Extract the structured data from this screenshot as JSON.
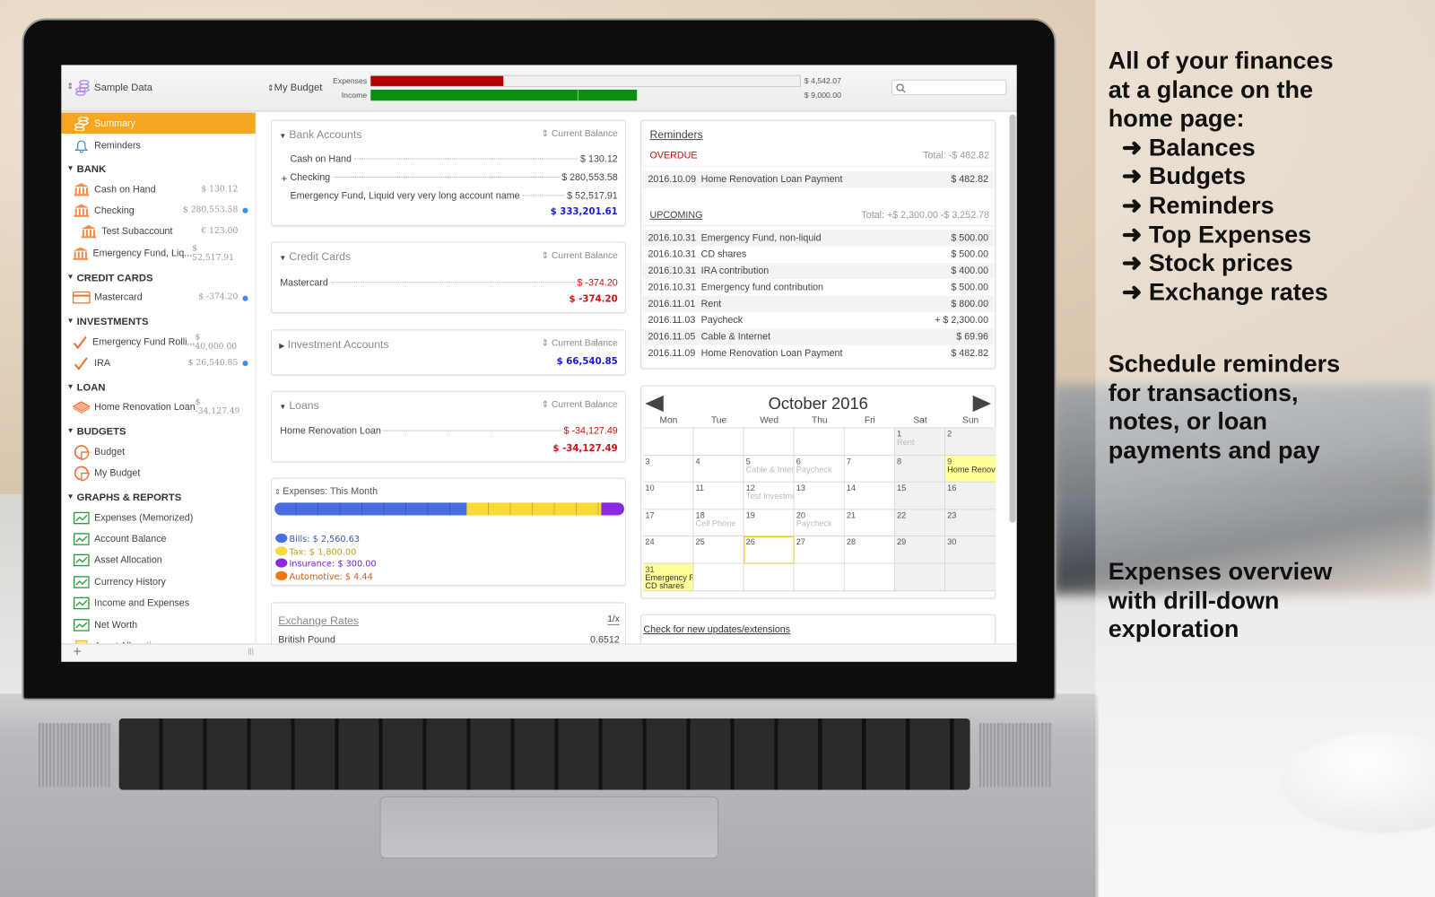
{
  "toolbar": {
    "file_name": "Sample Data",
    "budget_name": "My Budget",
    "expenses_label": "Expenses",
    "income_label": "Income",
    "expenses_amount": "$ 4,542.07",
    "income_amount": "$ 9,000.00",
    "expenses_fill_percent": 31,
    "income_fill_percent": 62,
    "income_marker_percent": 48,
    "expenses_color": "#b30000",
    "income_color": "#0a8f12",
    "search_placeholder": ""
  },
  "sidebar": {
    "accent": "#f5a623",
    "top": [
      {
        "label": "Summary",
        "icon": "coins-icon",
        "selected": true
      },
      {
        "label": "Reminders",
        "icon": "bell-icon"
      }
    ],
    "groups": [
      {
        "title": "BANK",
        "items": [
          {
            "label": "Cash on Hand",
            "value": "$ 130.12",
            "icon": "bank-icon"
          },
          {
            "label": "Checking",
            "value": "$ 280,553.58",
            "icon": "bank-icon",
            "dot": true
          },
          {
            "label": "Test Subaccount",
            "value": "€ 123.00",
            "icon": "bank-icon",
            "indent": true
          },
          {
            "label": "Emergency Fund, Liq...",
            "value": "$ 52,517.91",
            "icon": "bank-icon"
          }
        ]
      },
      {
        "title": "CREDIT CARDS",
        "items": [
          {
            "label": "Mastercard",
            "value": "$ -374.20",
            "icon": "credit-card-icon",
            "dot": true
          }
        ]
      },
      {
        "title": "INVESTMENTS",
        "items": [
          {
            "label": "Emergency Fund Rolli...",
            "value": "$ 40,000.00",
            "icon": "investment-icon"
          },
          {
            "label": "IRA",
            "value": "$ 26,540.85",
            "icon": "investment-icon",
            "dot": true
          }
        ]
      },
      {
        "title": "LOAN",
        "items": [
          {
            "label": "Home Renovation Loan",
            "value": "$ -34,127.49",
            "icon": "loan-icon"
          }
        ]
      },
      {
        "title": "BUDGETS",
        "items": [
          {
            "label": "Budget",
            "icon": "budget-icon"
          },
          {
            "label": "My Budget",
            "icon": "budget-icon"
          }
        ]
      },
      {
        "title": "GRAPHS & REPORTS",
        "items": [
          {
            "label": "Expenses (Memorized)",
            "icon": "graph-icon"
          },
          {
            "label": "Account Balance",
            "icon": "graph-icon"
          },
          {
            "label": "Asset Allocation",
            "icon": "graph-icon"
          },
          {
            "label": "Currency History",
            "icon": "graph-icon"
          },
          {
            "label": "Income and Expenses",
            "icon": "graph-icon"
          },
          {
            "label": "Net Worth",
            "icon": "graph-icon"
          },
          {
            "label": "Asset Allocation",
            "icon": "report-icon"
          }
        ]
      }
    ]
  },
  "bottombar": {
    "add_label": "+",
    "handle_label": "|||"
  },
  "cards": {
    "bank": {
      "title": "Bank Accounts",
      "sort": "Current Balance",
      "rows": [
        {
          "label": "Cash on Hand",
          "amount": "$ 130.12"
        },
        {
          "label": "Checking",
          "amount": "$ 280,553.58",
          "expand": "+"
        },
        {
          "label": "Emergency Fund, Liquid very very long account name",
          "amount": "$ 52,517.91"
        }
      ],
      "total": "$ 333,201.61"
    },
    "credit": {
      "title": "Credit Cards",
      "sort": "Current Balance",
      "rows": [
        {
          "label": "Mastercard",
          "amount": "$ -374.20"
        }
      ],
      "total": "$ -374.20"
    },
    "investment": {
      "title": "Investment Accounts",
      "sort": "Current Balance",
      "total": "$ 66,540.85"
    },
    "loans": {
      "title": "Loans",
      "sort": "Current Balance",
      "rows": [
        {
          "label": "Home Renovation Loan",
          "amount": "$ -34,127.49"
        }
      ],
      "total": "$ -34,127.49"
    },
    "expenses": {
      "title": "Expenses: This Month",
      "categories": [
        {
          "name": "Bills",
          "amount": "$ 2,560.63",
          "value": 2560.63,
          "color": "#4a6ee0",
          "text_color": "#3a55c0"
        },
        {
          "name": "Tax",
          "amount": "$ 1,800.00",
          "value": 1800.0,
          "color": "#f7d93a",
          "text_color": "#b8a020"
        },
        {
          "name": "Insurance",
          "amount": "$ 300.00",
          "value": 300.0,
          "color": "#8a2be2",
          "text_color": "#7a1fd0"
        },
        {
          "name": "Automotive",
          "amount": "$ 4.44",
          "value": 4.44,
          "color": "#f07a10",
          "text_color": "#d06010"
        }
      ]
    },
    "exchange": {
      "title": "Exchange Rates",
      "toggle": "1/x",
      "rows": [
        {
          "label": "British Pound",
          "value": "0.6512"
        }
      ]
    },
    "reminders": {
      "title": "Reminders",
      "overdue": {
        "label": "OVERDUE",
        "total": "Total:  -$ 482.82",
        "rows": [
          {
            "date": "2016.10.09",
            "desc": "Home Renovation Loan Payment",
            "amount": "$ 482.82"
          }
        ]
      },
      "upcoming": {
        "label": "UPCOMING",
        "total": "Total:  +$ 2,300.00 -$ 3,252.78",
        "rows": [
          {
            "date": "2016.10.31",
            "desc": "Emergency Fund, non-liquid",
            "amount": "$ 500.00"
          },
          {
            "date": "2016.10.31",
            "desc": "CD shares",
            "amount": "$ 500.00"
          },
          {
            "date": "2016.10.31",
            "desc": "IRA contribution",
            "amount": "$ 400.00"
          },
          {
            "date": "2016.10.31",
            "desc": "Emergency fund contribution",
            "amount": "$ 500.00"
          },
          {
            "date": "2016.11.01",
            "desc": "Rent",
            "amount": "$ 800.00"
          },
          {
            "date": "2016.11.03",
            "desc": "Paycheck",
            "amount": "+ $ 2,300.00"
          },
          {
            "date": "2016.11.05",
            "desc": "Cable & Internet",
            "amount": "$ 69.96"
          },
          {
            "date": "2016.11.09",
            "desc": "Home Renovation Loan Payment",
            "amount": "$ 482.82"
          }
        ]
      }
    },
    "calendar": {
      "title": "October 2016",
      "weekdays": [
        "Mon",
        "Tue",
        "Wed",
        "Thu",
        "Fri",
        "Sat",
        "Sun"
      ],
      "today": 26,
      "highlight_color": "#ffff99",
      "weeks": [
        [
          null,
          null,
          null,
          null,
          null,
          1,
          2
        ],
        [
          3,
          4,
          5,
          6,
          7,
          8,
          9
        ],
        [
          10,
          11,
          12,
          13,
          14,
          15,
          16
        ],
        [
          17,
          18,
          19,
          20,
          21,
          22,
          23
        ],
        [
          24,
          25,
          26,
          27,
          28,
          29,
          30
        ],
        [
          31,
          null,
          null,
          null,
          null,
          null,
          null
        ]
      ],
      "events": {
        "1": [
          "Rent"
        ],
        "5": [
          "Cable & Intern"
        ],
        "6": [
          "Paycheck"
        ],
        "9": [
          "Home Renova"
        ],
        "12": [
          "Test Investme"
        ],
        "18": [
          "Cell Phone"
        ],
        "20": [
          "Paycheck"
        ],
        "31": [
          "Emergency Fu",
          "CD shares"
        ]
      },
      "highlighted": [
        9,
        31
      ]
    },
    "updates": {
      "link": "Check for new updates/extensions"
    }
  },
  "promo": {
    "lines": [
      "All of your finances",
      "at a glance on the",
      "home page:",
      "  ➜ Balances",
      "  ➜ Budgets",
      "  ➜ Reminders",
      "  ➜ Top Expenses",
      "  ➜ Stock prices",
      "  ➜ Exchange rates"
    ],
    "lines2": [
      "Schedule reminders",
      "for transactions,",
      "notes, or loan",
      "payments and pay"
    ],
    "lines3": [
      "Expenses overview",
      "with drill-down",
      "exploration"
    ]
  }
}
